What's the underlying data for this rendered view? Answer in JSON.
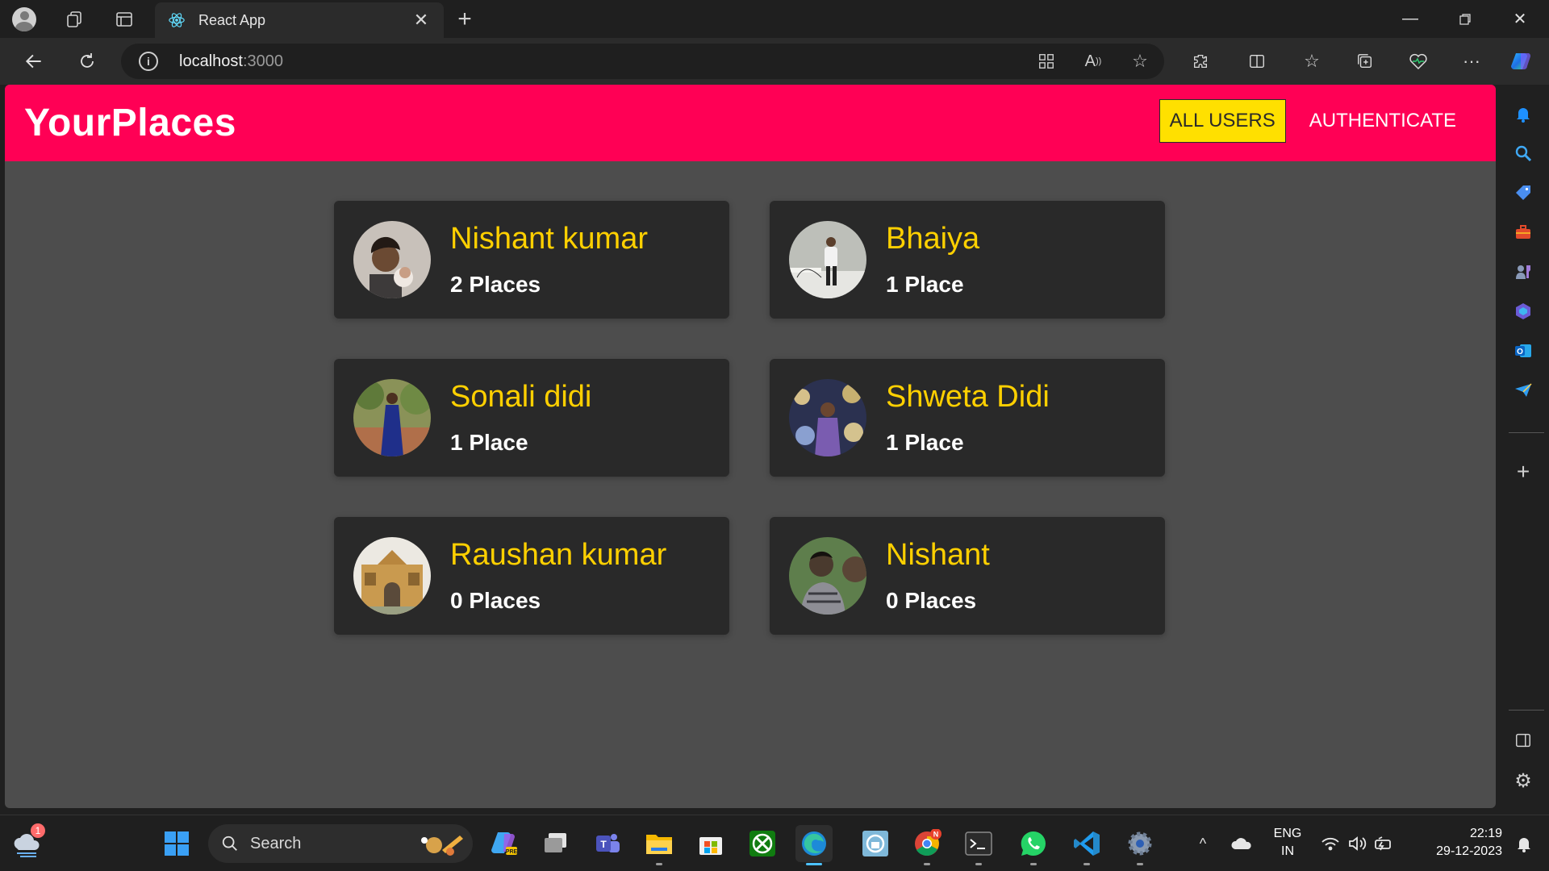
{
  "browser": {
    "tab_title": "React App",
    "url_host": "localhost",
    "url_port": ":3000"
  },
  "app": {
    "brand": "YourPlaces",
    "nav": [
      {
        "label": "ALL USERS",
        "active": true
      },
      {
        "label": "AUTHENTICATE",
        "active": false
      }
    ],
    "users": [
      {
        "name": "Nishant kumar",
        "places": "2 Places",
        "avatar_colors": [
          "#c9c2bb",
          "#6b4a33"
        ]
      },
      {
        "name": "Bhaiya",
        "places": "1 Place",
        "avatar_colors": [
          "#c7c9c4",
          "#e9e9e4"
        ]
      },
      {
        "name": "Sonali didi",
        "places": "1 Place",
        "avatar_colors": [
          "#7e8a4a",
          "#213690"
        ]
      },
      {
        "name": "Shweta Didi",
        "places": "1 Place",
        "avatar_colors": [
          "#2b3150",
          "#d7c7a0"
        ]
      },
      {
        "name": "Raushan kumar",
        "places": "0 Places",
        "avatar_colors": [
          "#e7e4dc",
          "#b89048"
        ]
      },
      {
        "name": "Nishant",
        "places": "0 Places",
        "avatar_colors": [
          "#5e7e4c",
          "#4a3a2e"
        ]
      }
    ]
  },
  "taskbar": {
    "search_label": "Search",
    "weather_badge": "1",
    "lang_top": "ENG",
    "lang_bottom": "IN",
    "time": "22:19",
    "date": "29-12-2023"
  },
  "colors": {
    "header": "#ff0055",
    "accent_text": "#ffd000",
    "active_nav": "#ffe000",
    "card": "#292929",
    "page_bg": "#4d4d4d"
  }
}
